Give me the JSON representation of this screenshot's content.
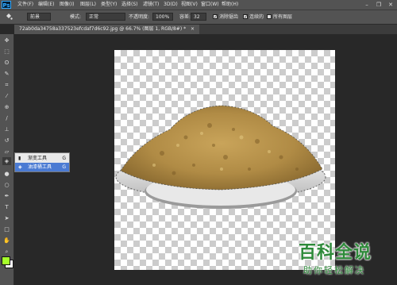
{
  "app": {
    "logo": "Ps"
  },
  "menubar": {
    "items": [
      "文件(F)",
      "编辑(E)",
      "图像(I)",
      "图层(L)",
      "类型(Y)",
      "选择(S)",
      "滤镜(T)",
      "3D(D)",
      "视图(V)",
      "窗口(W)",
      "帮助(H)"
    ]
  },
  "window_controls": {
    "minimize": "–",
    "restore": "❐",
    "close": "✕"
  },
  "options_bar": {
    "fill_label": "前景",
    "mode_label": "模式:",
    "mode_value": "正常",
    "opacity_label": "不透明度:",
    "opacity_value": "100%",
    "tolerance_label": "容差:",
    "tolerance_value": "32",
    "antialias_label": "消除锯齿",
    "contiguous_label": "连续的",
    "all_layers_label": "所有图层",
    "antialias_checked": true,
    "contiguous_checked": true,
    "all_layers_checked": false
  },
  "document_tab": {
    "title": "72ab0da34758a337523efcdaf7d6c92.jpg @ 66.7% (图层 1, RGB/8#) *",
    "close": "×"
  },
  "tools": [
    "move-tool",
    "marquee-tool",
    "lasso-tool",
    "quick-select-tool",
    "crop-tool",
    "eyedropper-tool",
    "healing-brush-tool",
    "brush-tool",
    "clone-stamp-tool",
    "history-brush-tool",
    "eraser-tool",
    "paint-bucket-tool",
    "blur-tool",
    "dodge-tool",
    "pen-tool",
    "type-tool",
    "path-select-tool",
    "rectangle-tool",
    "hand-tool",
    "zoom-tool"
  ],
  "tool_flyout": {
    "items": [
      {
        "label": "渐变工具",
        "key": "G"
      },
      {
        "label": "油漆桶工具",
        "key": "G"
      }
    ]
  },
  "colors": {
    "foreground": "#a6ff2a",
    "background": "#ffffff",
    "accent": "#4b7bd3"
  },
  "watermark": {
    "title": "百科全说",
    "subtitle": "助你轻松解决"
  }
}
